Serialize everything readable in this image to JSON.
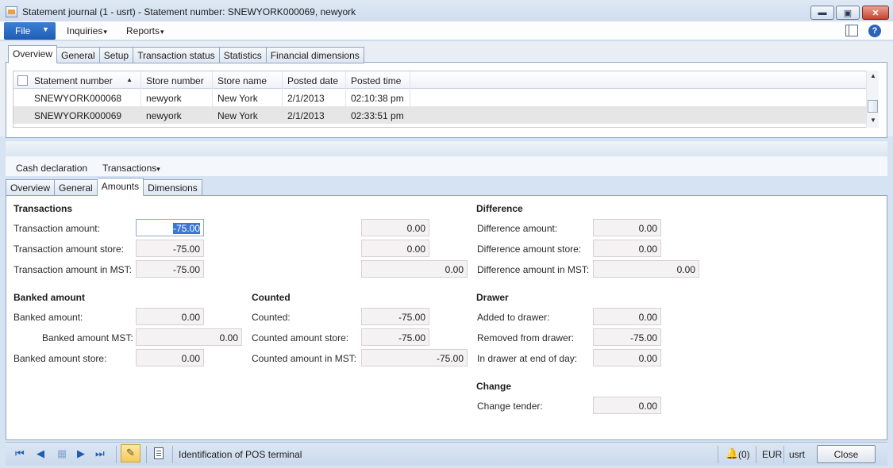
{
  "window": {
    "title": "Statement journal (1 - usrt) - Statement number: SNEWYORK000069, newyork",
    "minimize_glyph": "▬",
    "maximize_glyph": "▣",
    "close_glyph": "✕"
  },
  "menu": {
    "file": "File",
    "file_arrow": "▼",
    "inquiries": "Inquiries",
    "reports": "Reports",
    "caret": "▾",
    "help_glyph": "?"
  },
  "top_tabs": [
    "Overview",
    "General",
    "Setup",
    "Transaction status",
    "Statistics",
    "Financial dimensions"
  ],
  "grid": {
    "columns": [
      "Statement number",
      "Store number",
      "Store name",
      "Posted date",
      "Posted time"
    ],
    "sort_glyph": "▲",
    "rows": [
      [
        "SNEWYORK000068",
        "newyork",
        "New York",
        "2/1/2013",
        "02:10:38 pm"
      ],
      [
        "SNEWYORK000069",
        "newyork",
        "New York",
        "2/1/2013",
        "02:33:51 pm"
      ]
    ],
    "scroll_up": "▲",
    "scroll_down": "▼"
  },
  "action_bar": {
    "cash_declaration": "Cash declaration",
    "transactions": "Transactions"
  },
  "bottom_tabs": [
    "Overview",
    "General",
    "Amounts",
    "Dimensions"
  ],
  "transactions": {
    "title": "Transactions",
    "amount_label": "Transaction amount:",
    "amount_value": "-75.00",
    "store_label": "Transaction amount store:",
    "store_value": "-75.00",
    "mst_label": "Transaction amount in MST:",
    "mst_value": "-75.00",
    "col2_amount": "0.00",
    "col2_store": "0.00",
    "col2_mst": "0.00"
  },
  "difference": {
    "title": "Difference",
    "amount_label": "Difference amount:",
    "amount_value": "0.00",
    "store_label": "Difference amount store:",
    "store_value": "0.00",
    "mst_label": "Difference amount in MST:",
    "mst_value": "0.00"
  },
  "banked": {
    "title": "Banked amount",
    "amount_label": "Banked amount:",
    "amount_value": "0.00",
    "mst_label": "Banked amount MST:",
    "mst_value": "0.00",
    "store_label": "Banked amount store:",
    "store_value": "0.00"
  },
  "counted": {
    "title": "Counted",
    "amount_label": "Counted:",
    "amount_value": "-75.00",
    "store_label": "Counted amount store:",
    "store_value": "-75.00",
    "mst_label": "Counted amount in MST:",
    "mst_value": "-75.00"
  },
  "drawer": {
    "title": "Drawer",
    "added_label": "Added to drawer:",
    "added_value": "0.00",
    "removed_label": "Removed from drawer:",
    "removed_value": "-75.00",
    "end_label": "In drawer at end of day:",
    "end_value": "0.00"
  },
  "change": {
    "title": "Change",
    "tender_label": "Change tender:",
    "tender_value": "0.00"
  },
  "statusbar": {
    "nav_first": "⏮",
    "nav_prev": "◀",
    "nav_list": "▦",
    "nav_next": "▶",
    "nav_last": "⏭",
    "edit_glyph": "✎",
    "help_text": "Identification of POS terminal",
    "bell_glyph": "🔔",
    "notifications": "(0)",
    "currency": "EUR",
    "company": "usrt",
    "close": "Close"
  }
}
